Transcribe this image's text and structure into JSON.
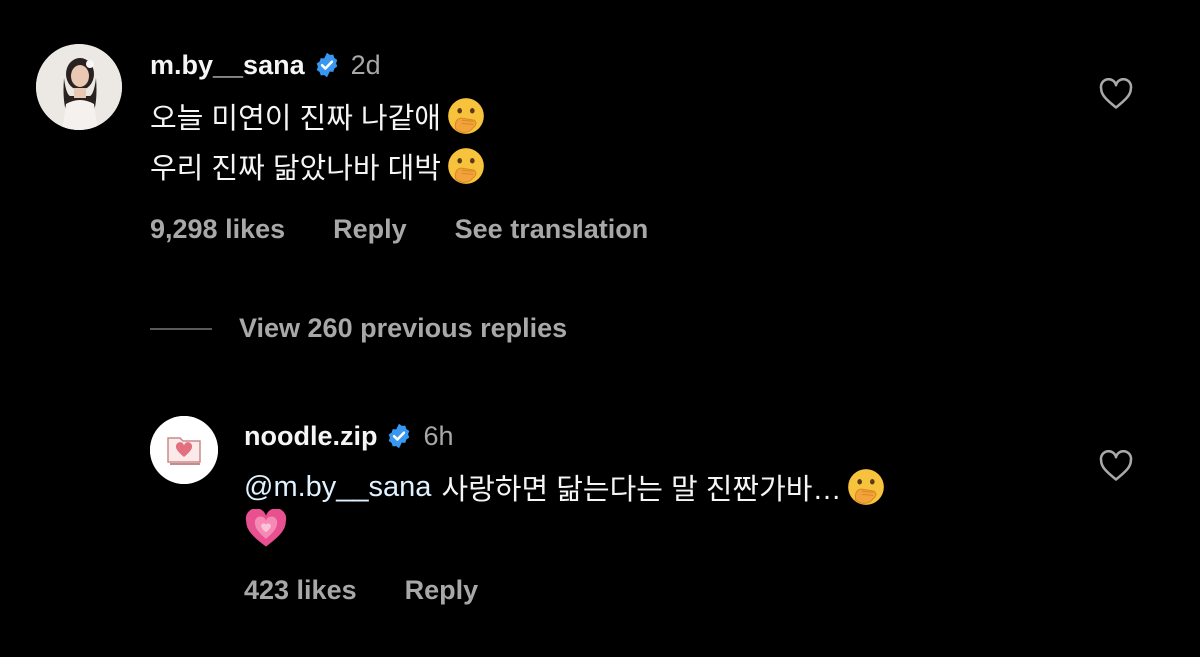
{
  "comments": [
    {
      "username": "m.by__sana",
      "time": "2d",
      "lines": [
        "오늘 미연이 진짜 나같애",
        "우리 진짜 닮았나바 대박"
      ],
      "likes": "9,298 likes",
      "reply": "Reply",
      "translate": "See translation"
    }
  ],
  "view_replies": "View 260 previous replies",
  "reply": {
    "username": "noodle.zip",
    "time": "6h",
    "mention": "@m.by__sana",
    "text": "사랑하면 닮는다는 말 진짠가바…",
    "likes": "423 likes",
    "reply": "Reply"
  },
  "colors": {
    "background": "#000000",
    "verified": "#3897f0",
    "muted": "#a8a8a8",
    "mention": "#e0f1ff"
  },
  "icons": [
    "verified-badge-icon",
    "heart-outline-icon",
    "shushing-face-emoji",
    "growing-heart-emoji"
  ]
}
